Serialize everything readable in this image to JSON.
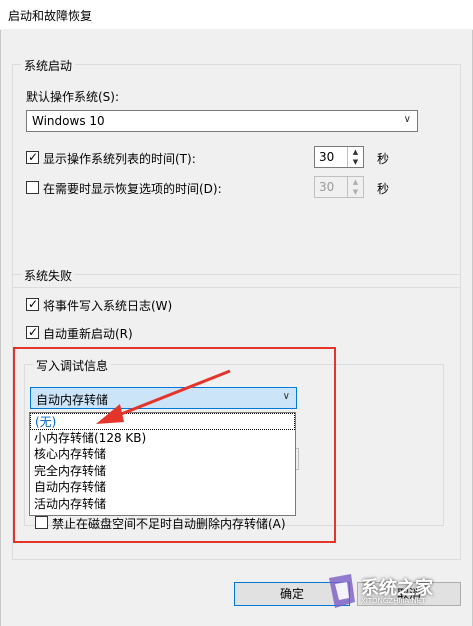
{
  "window": {
    "title": "启动和故障恢复"
  },
  "system_startup": {
    "group_title": "系统启动",
    "default_os_label": "默认操作系统(S):",
    "default_os_value": "Windows 10",
    "show_os_list_label": "显示操作系统列表的时间(T):",
    "show_os_list_value": "30",
    "show_recovery_label": "在需要时显示恢复选项的时间(D):",
    "show_recovery_value": "30",
    "seconds_unit_1": "秒",
    "seconds_unit_2": "秒"
  },
  "system_failure": {
    "group_title": "系统失败",
    "write_event_label": "将事件写入系统日志(W)",
    "auto_restart_label": "自动重新启动(R)"
  },
  "debug_info": {
    "group_title": "写入调试信息",
    "selected_value": "自动内存转储",
    "options": [
      "(无)",
      "小内存转储(128 KB)",
      "核心内存转储",
      "完全内存转储",
      "自动内存转储",
      "活动内存转储"
    ],
    "disable_auto_delete_label": "禁止在磁盘空间不足时自动删除内存转储(A)"
  },
  "buttons": {
    "ok": "确定",
    "cancel": "取消"
  },
  "watermark": {
    "text": "系统之家",
    "url": "XITONGZHIJIA.NET"
  },
  "colors": {
    "highlight_red": "#e5352b",
    "selection_blue": "#cce4f7"
  }
}
